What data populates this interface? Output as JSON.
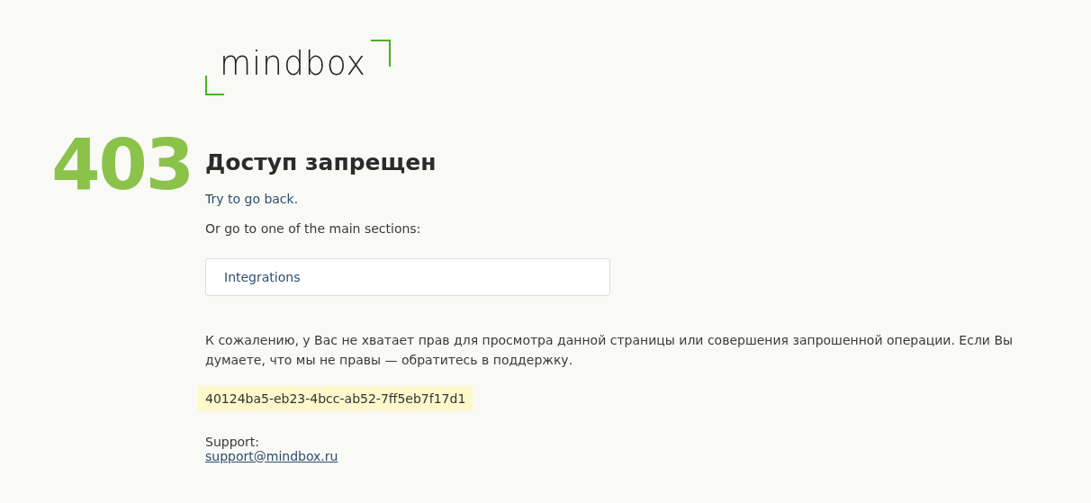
{
  "logo": {
    "text": "mindbox"
  },
  "error": {
    "code": "403",
    "title": "Доступ запрещен"
  },
  "back_link": "Try to go back.",
  "sections_prompt": "Or go to one of the main sections:",
  "sections": [
    {
      "label": "Integrations"
    }
  ],
  "message": "К сожалению, у Вас не хватает прав для просмотра данной страницы или совершения запрошенной операции. Если Вы думаете, что мы не правы — обратитесь в поддержку.",
  "request_id": "40124ba5-eb23-4bcc-ab52-7ff5eb7f17d1",
  "support": {
    "label": "Support:",
    "email": "support@mindbox.ru"
  }
}
